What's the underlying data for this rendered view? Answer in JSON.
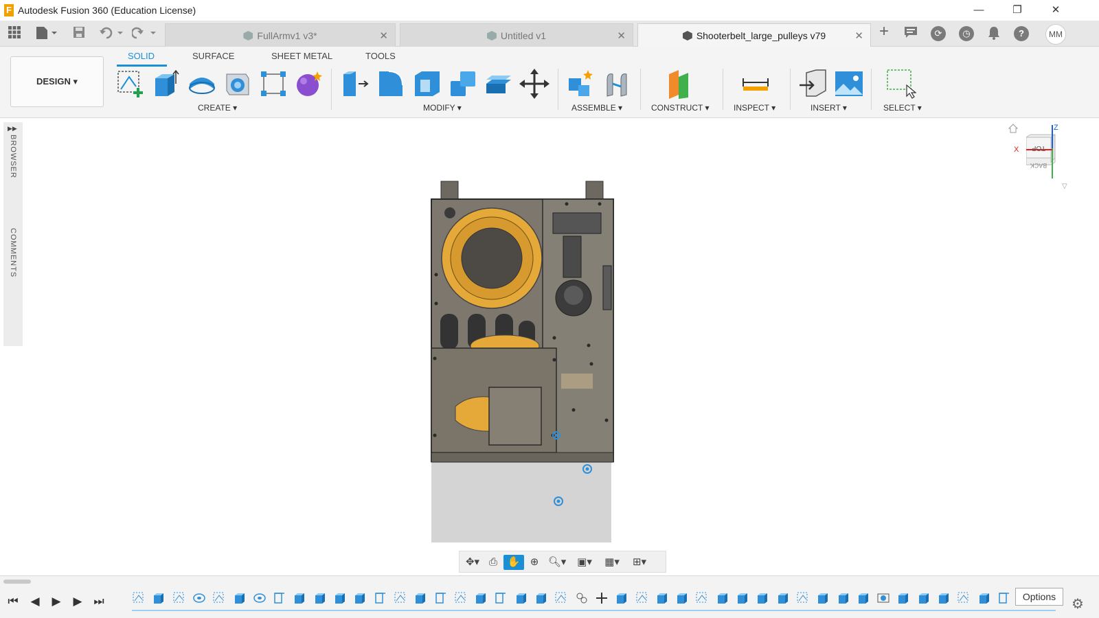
{
  "window": {
    "title": "Autodesk Fusion 360 (Education License)",
    "logo_letter": "F",
    "minimize": "—",
    "restore": "❐",
    "close": "✕"
  },
  "tabs": [
    {
      "label": "FullArmv1 v3*",
      "active": false
    },
    {
      "label": "Untitled v1",
      "active": false
    },
    {
      "label": "Shooterbelt_large_pulleys v79",
      "active": true
    }
  ],
  "tab_close": "✕",
  "tab_new": "+",
  "user_initials": "MM",
  "ribbon": {
    "workspace": "DESIGN ▾",
    "tabs": [
      "SOLID",
      "SURFACE",
      "SHEET METAL",
      "TOOLS"
    ],
    "groups": {
      "create": "CREATE ▾",
      "modify": "MODIFY ▾",
      "assemble": "ASSEMBLE ▾",
      "construct": "CONSTRUCT ▾",
      "inspect": "INSPECT ▾",
      "insert": "INSERT ▾",
      "select": "SELECT ▾"
    }
  },
  "side_panel": {
    "browser": "BROWSER",
    "comments": "COMMENTS",
    "expand": "▶▶"
  },
  "viewcube": {
    "face_top": "TOP",
    "face_back": "BACK",
    "axis_x": "X",
    "axis_z": "Z"
  },
  "timeline": {
    "options": "Options",
    "first": "⏮",
    "prev": "◀",
    "play": "▶",
    "next": "▶",
    "last": "⏭"
  },
  "colors": {
    "accent": "#1a8fd6",
    "pulley": "#e5a93a",
    "chassis": "#7d776d",
    "plate": "#d4d4d4"
  }
}
